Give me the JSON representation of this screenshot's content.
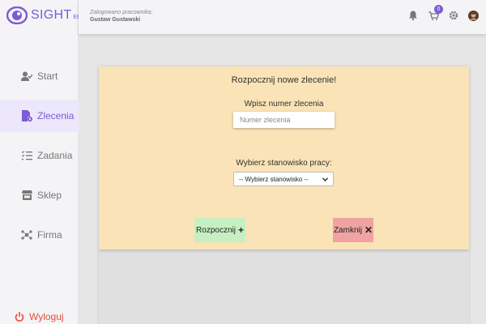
{
  "app": {
    "name": "SIGHT",
    "suffix": "ERP",
    "accent": "#7b5bd6"
  },
  "header": {
    "employee_label": "Zalogowano pracownika:",
    "employee_name": "Gustaw Gustawski",
    "cart_count": "0",
    "icons": [
      "bell-icon",
      "cart-icon",
      "gear-icon",
      "avatar"
    ]
  },
  "sidebar": {
    "items": [
      {
        "label": "Start",
        "icon": "user-check-icon"
      },
      {
        "label": "Zlecenia",
        "icon": "file-gear-icon",
        "active": true
      },
      {
        "label": "Zadania",
        "icon": "tasks-icon"
      },
      {
        "label": "Sklep",
        "icon": "store-icon"
      },
      {
        "label": "Firma",
        "icon": "network-icon"
      }
    ],
    "logout_label": "Wyloguj"
  },
  "card": {
    "title": "Rozpocznij nowe zlecenie!",
    "order_label": "Wpisz numer zlecenia",
    "order_placeholder": "Numer zlecenia",
    "order_value": "",
    "station_label": "Wybierz stanowisko pracy:",
    "station_selected": "-- Wybierz stanowisko --",
    "start_label": "Rozpocznij",
    "close_label": "Zamknij",
    "colors": {
      "card": "#fae3b6",
      "start": "#c6f0c2",
      "close": "#f0a3a3"
    }
  }
}
